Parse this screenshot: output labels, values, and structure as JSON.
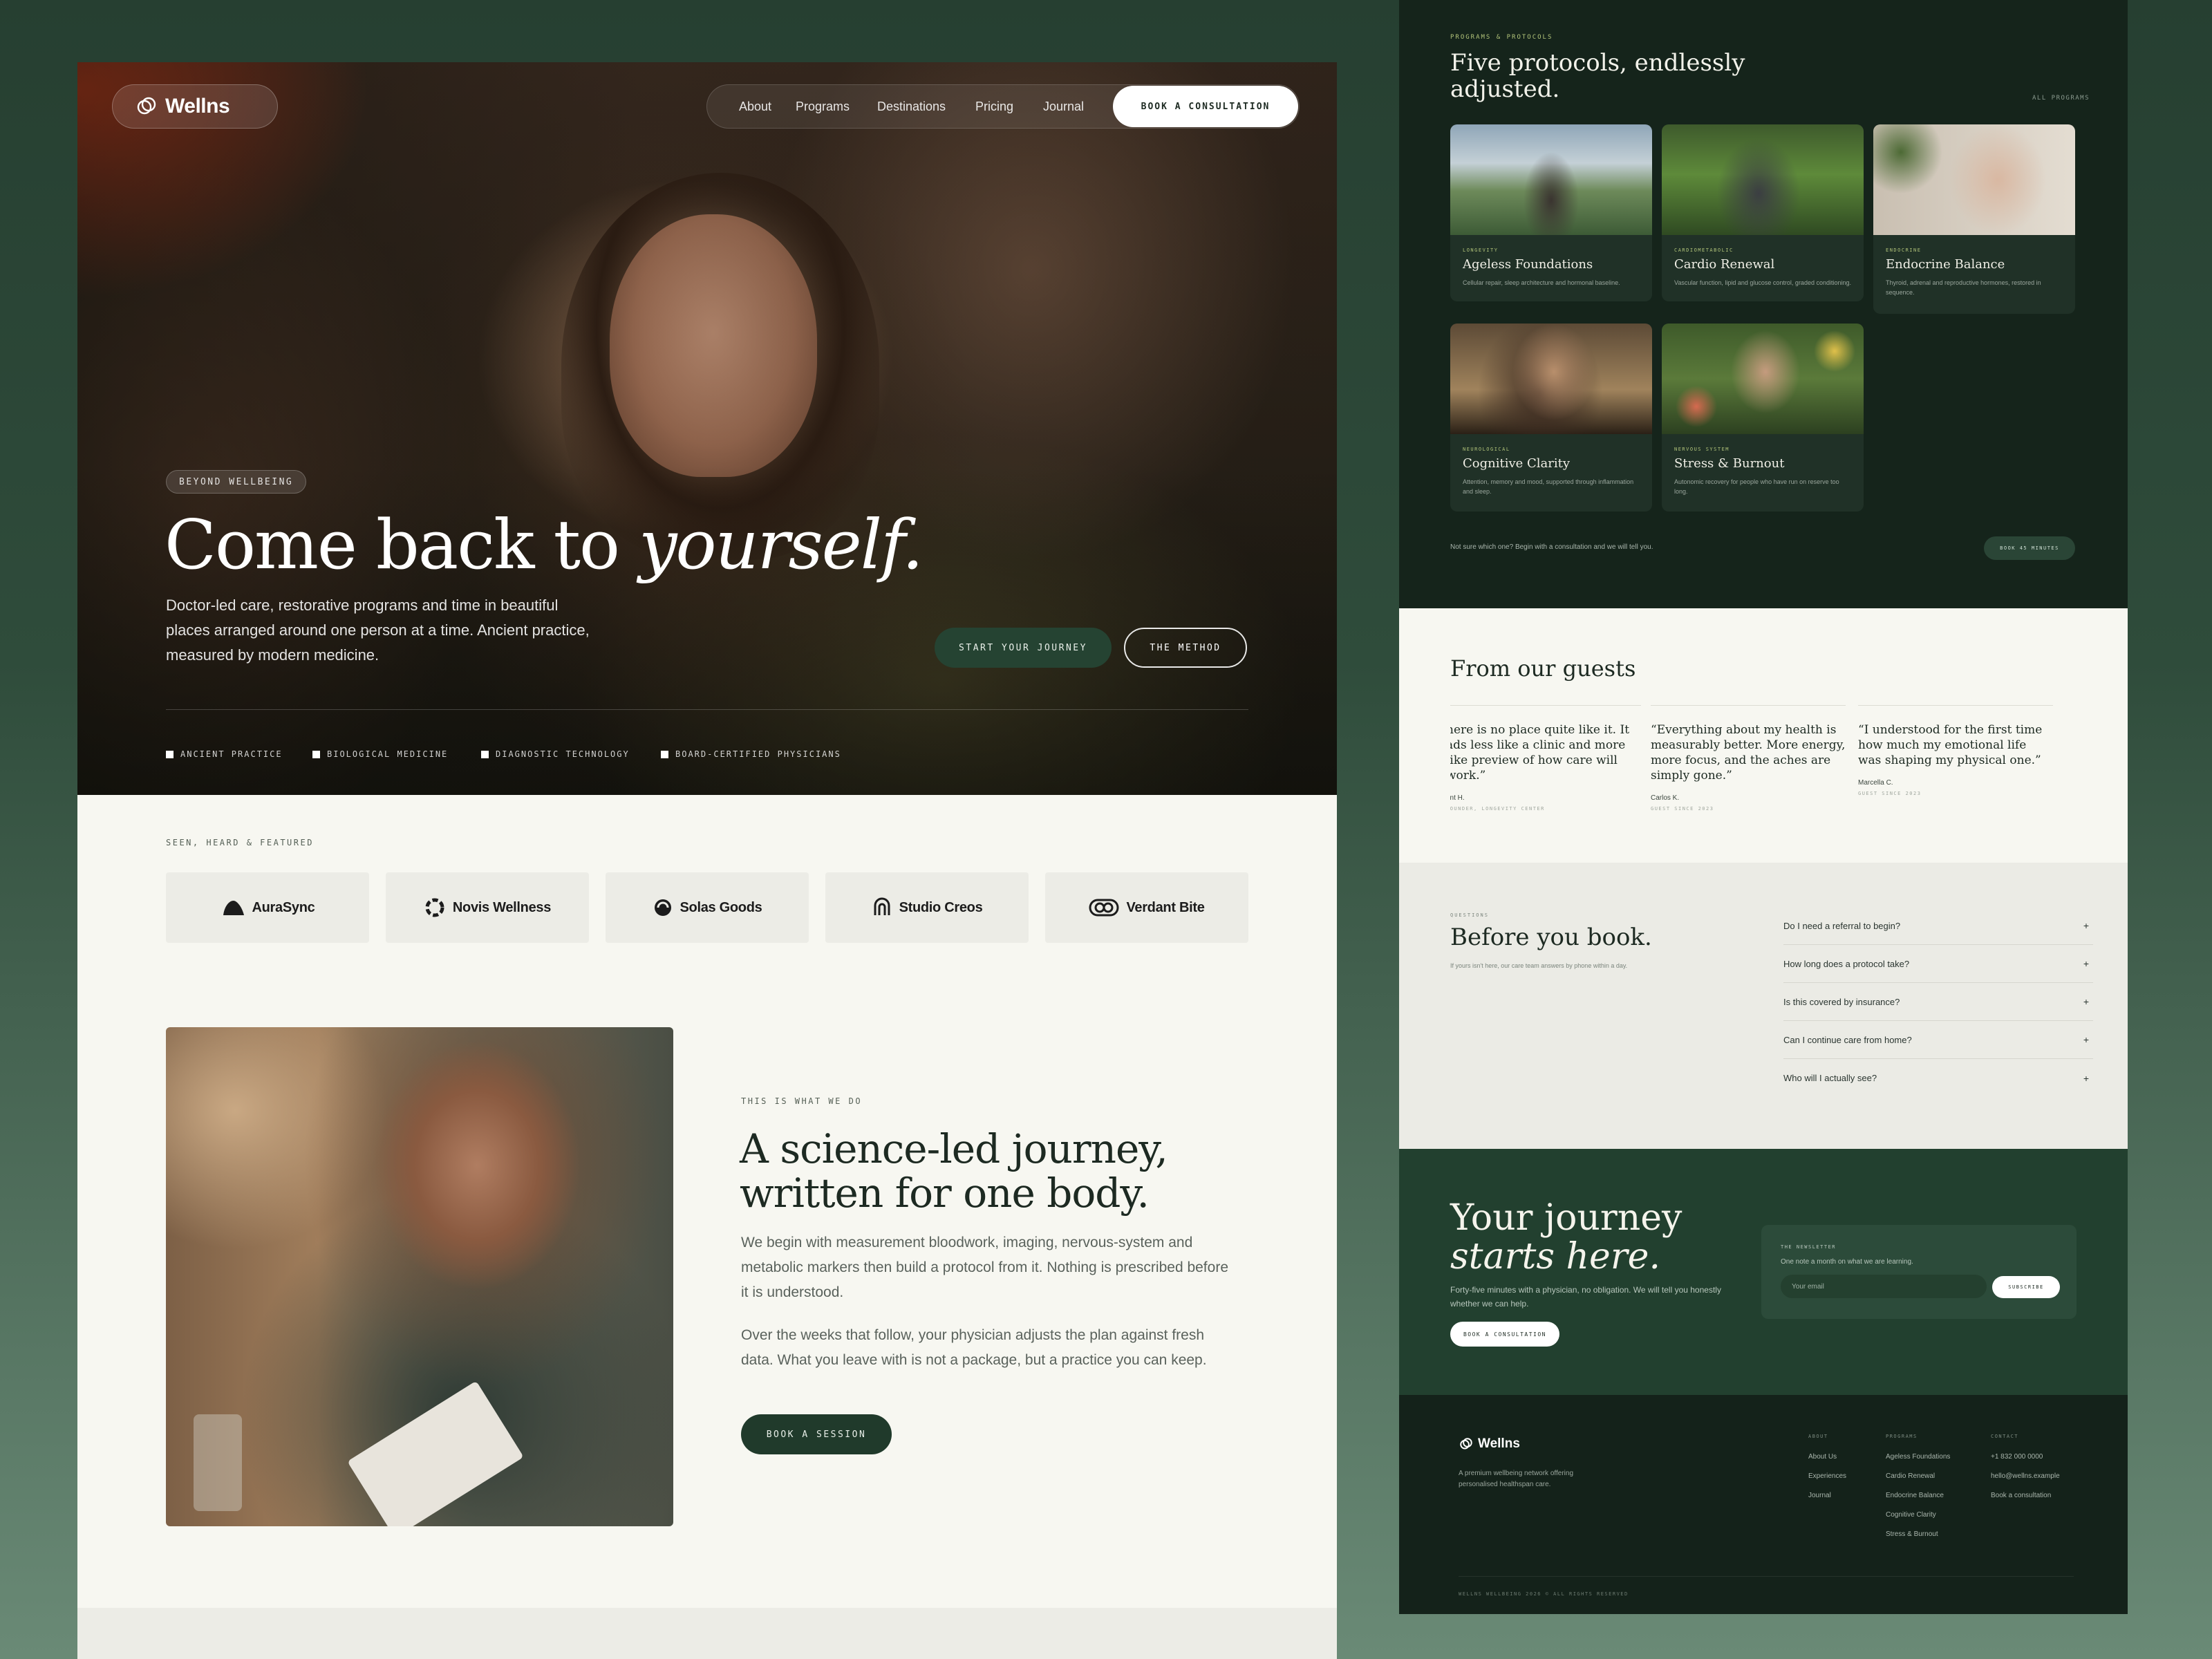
{
  "brand": {
    "name": "Wellns"
  },
  "nav": {
    "items": [
      "About",
      "Programs",
      "Destinations",
      "Pricing",
      "Journal"
    ],
    "cta": "BOOK A CONSULTATION"
  },
  "hero": {
    "badge": "BEYOND WELLBEING",
    "title_pre": "Come back to ",
    "title_em": "yourself.",
    "desc": "Doctor-led care, restorative programs and time in beautiful places arranged around one person at a time. Ancient practice, measured by modern medicine.",
    "primary_cta": "START YOUR JOURNEY",
    "secondary_cta": "THE METHOD",
    "features": [
      "ANCIENT PRACTICE",
      "BIOLOGICAL MEDICINE",
      "DIAGNOSTIC TECHNOLOGY",
      "BOARD-CERTIFIED PHYSICIANS"
    ]
  },
  "featured": {
    "label": "SEEN, HEARD & FEATURED",
    "brands": [
      "AuraSync",
      "Novis Wellness",
      "Solas Goods",
      "Studio Creos",
      "Verdant Bite"
    ]
  },
  "journey": {
    "label": "THIS IS WHAT WE DO",
    "title": "A science-led journey, written for one body.",
    "p1": "We begin with measurement bloodwork, imaging, nervous-system and metabolic markers then build a protocol from it. Nothing is prescribed before it is understood.",
    "p2": "Over the weeks that follow, your physician adjusts the plan against fresh data. What you leave with is not a package, but a practice you can keep.",
    "cta": "BOOK A SESSION"
  },
  "programs": {
    "label": "PROGRAMS & PROTOCOLS",
    "title": "Five protocols, endlessly adjusted.",
    "all_link": "ALL PROGRAMS",
    "cards": [
      {
        "tag": "LONGEVITY",
        "name": "Ageless Foundations",
        "desc": "Cellular repair, sleep architecture and hormonal baseline."
      },
      {
        "tag": "CARDIOMETABOLIC",
        "name": "Cardio Renewal",
        "desc": "Vascular function, lipid and glucose control, graded conditioning."
      },
      {
        "tag": "ENDOCRINE",
        "name": "Endocrine Balance",
        "desc": "Thyroid, adrenal and reproductive hormones, restored in sequence."
      },
      {
        "tag": "NEUROLOGICAL",
        "name": "Cognitive Clarity",
        "desc": "Attention, memory and mood, supported through inflammation and sleep."
      },
      {
        "tag": "NERVOUS SYSTEM",
        "name": "Stress & Burnout",
        "desc": "Autonomic recovery for people who have run on reserve too long."
      }
    ],
    "note": "Not sure which one? Begin with a consultation and we will tell you.",
    "cta": "BOOK 45 MINUTES"
  },
  "guests": {
    "title": "From our guests",
    "quotes": [
      {
        "text": "here is no place quite like it. It ads less like a clinic and more like preview of how care will work.”",
        "name": "ant H.",
        "role": "FOUNDER, LONGEVITY CENTER"
      },
      {
        "text": "“Everything about my health is measurably better. More energy, more focus, and the aches are simply gone.”",
        "name": "Carlos K.",
        "role": "GUEST SINCE 2023"
      },
      {
        "text": "“I understood for the first time how much my emotional life was shaping my physical one.”",
        "name": "Marcella C.",
        "role": "GUEST SINCE 2023"
      }
    ]
  },
  "faq": {
    "label": "QUESTIONS",
    "title": "Before you book.",
    "sub": "If yours isn't here, our care team answers by phone within a day.",
    "items": [
      "Do I need a referral to begin?",
      "How long does a protocol take?",
      "Is this covered by insurance?",
      "Can I continue care from home?",
      "Who will I actually see?"
    ]
  },
  "cta": {
    "title_1": "Your journey",
    "title_2": "starts here.",
    "desc": "Forty-five minutes with a physician, no obligation. We will tell you honestly whether we can help.",
    "button": "BOOK A CONSULTATION",
    "newsletter_label": "THE NEWSLETTER",
    "newsletter_sub": "One note a month on what we are learning.",
    "input_placeholder": "Your email",
    "subscribe": "SUBSCRIBE"
  },
  "footer": {
    "tagline": "A premium wellbeing network offering personalised healthspan care.",
    "cols": [
      {
        "heading": "ABOUT",
        "links": [
          "About Us",
          "Experiences",
          "Journal"
        ]
      },
      {
        "heading": "PROGRAMS",
        "links": [
          "Ageless Foundations",
          "Cardio Renewal",
          "Endocrine Balance",
          "Cognitive Clarity",
          "Stress & Burnout"
        ]
      },
      {
        "heading": "CONTACT",
        "links": [
          "+1 832 000 0000",
          "hello@wellns.example",
          "Book a consultation"
        ]
      }
    ],
    "copyright": "WELLNS WELLBEING 2026 © ALL RIGHTS RESERVED"
  },
  "colors": {
    "accent_dark": "#22402f",
    "panel_dark": "#15241b",
    "cream": "#f7f7f1",
    "lime": "#b2c47a"
  }
}
